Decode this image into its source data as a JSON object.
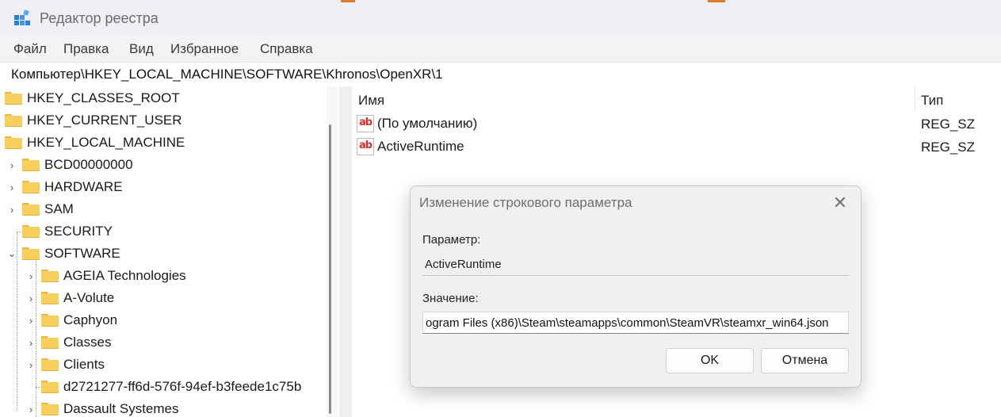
{
  "window": {
    "title": "Редактор реестра"
  },
  "menu": {
    "items": [
      "Файл",
      "Правка",
      "Вид",
      "Избранное",
      "Справка"
    ]
  },
  "address": {
    "path": "Компьютер\\HKEY_LOCAL_MACHINE\\SOFTWARE\\Khronos\\OpenXR\\1"
  },
  "tree": {
    "items": [
      {
        "label": "HKEY_CLASSES_ROOT",
        "level": 0,
        "expander": ""
      },
      {
        "label": "HKEY_CURRENT_USER",
        "level": 0,
        "expander": ""
      },
      {
        "label": "HKEY_LOCAL_MACHINE",
        "level": 0,
        "expander": ""
      },
      {
        "label": "BCD00000000",
        "level": 1,
        "expander": "›"
      },
      {
        "label": "HARDWARE",
        "level": 1,
        "expander": "›"
      },
      {
        "label": "SAM",
        "level": 1,
        "expander": "›"
      },
      {
        "label": "SECURITY",
        "level": 1,
        "expander": ""
      },
      {
        "label": "SOFTWARE",
        "level": 1,
        "expander": "⌄"
      },
      {
        "label": "AGEIA Technologies",
        "level": 2,
        "expander": "›"
      },
      {
        "label": "A-Volute",
        "level": 2,
        "expander": "›"
      },
      {
        "label": "Caphyon",
        "level": 2,
        "expander": "›"
      },
      {
        "label": "Classes",
        "level": 2,
        "expander": "›"
      },
      {
        "label": "Clients",
        "level": 2,
        "expander": "›"
      },
      {
        "label": "d2721277-ff6d-576f-94ef-b3feede1c75b",
        "level": 2,
        "expander": ""
      },
      {
        "label": "Dassault Systemes",
        "level": 2,
        "expander": "›"
      }
    ]
  },
  "values": {
    "headers": {
      "name": "Имя",
      "type": "Тип"
    },
    "rows": [
      {
        "name": "(По умолчанию)",
        "type": "REG_SZ",
        "icon": "ab"
      },
      {
        "name": "ActiveRuntime",
        "type": "REG_SZ",
        "icon": "ab"
      }
    ]
  },
  "dialog": {
    "title": "Изменение строкового параметра",
    "param_label": "Параметр:",
    "param_value": "ActiveRuntime",
    "value_label": "Значение:",
    "value_text": "ogram Files (x86)\\Steam\\steamapps\\common\\SteamVR\\steamxr_win64.json",
    "ok_label": "OK",
    "cancel_label": "Отмена"
  },
  "colors": {
    "folder": "#f6cf5c",
    "accent": "#e0782f",
    "ab_icon": "#d8302c"
  }
}
